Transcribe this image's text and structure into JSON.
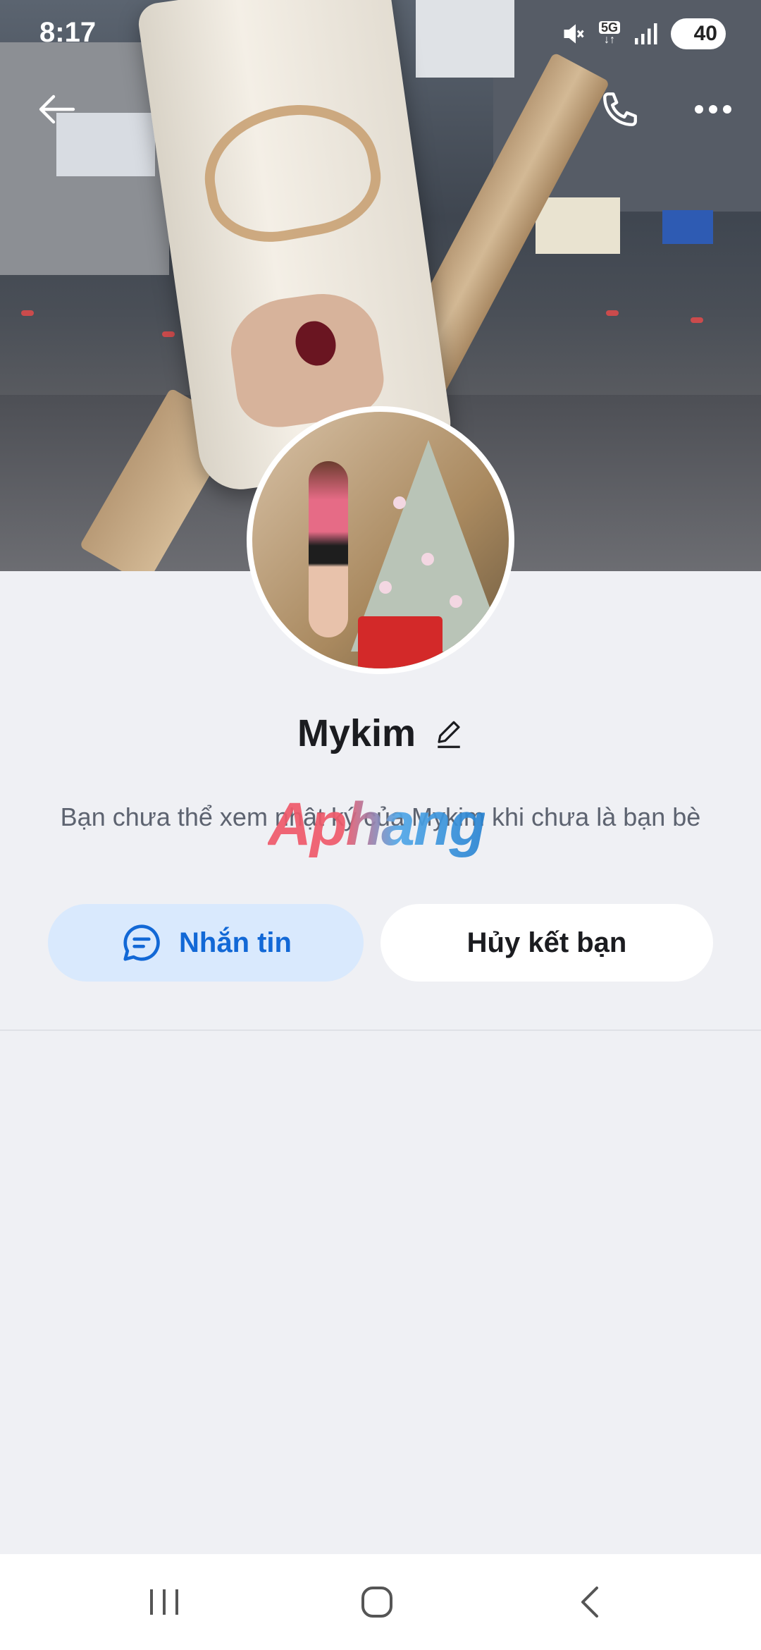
{
  "status_bar": {
    "time": "8:17",
    "network": "5G",
    "battery": "40",
    "icons": [
      "mute-icon",
      "5g-data-icon",
      "signal-icon",
      "battery-saver-icon"
    ]
  },
  "top_bar": {
    "icons": [
      "back-arrow-icon",
      "phone-icon",
      "more-dots-icon"
    ]
  },
  "profile": {
    "name": "Mykim",
    "edit_icon": "pencil-icon",
    "notice": "Bạn chưa thể xem nhật ký của Mykim khi chưa là bạn bè",
    "watermark": "Aphang"
  },
  "actions": {
    "message_label": "Nhắn tin",
    "message_icon": "chat-bubble-icon",
    "unfriend_label": "Hủy kết bạn"
  },
  "colors": {
    "accent": "#1268d6",
    "message_button_bg": "#d9e9fd",
    "page_bg": "#eff0f4"
  },
  "nav_bar": {
    "icons": [
      "recent-apps-icon",
      "home-icon",
      "back-icon"
    ]
  }
}
